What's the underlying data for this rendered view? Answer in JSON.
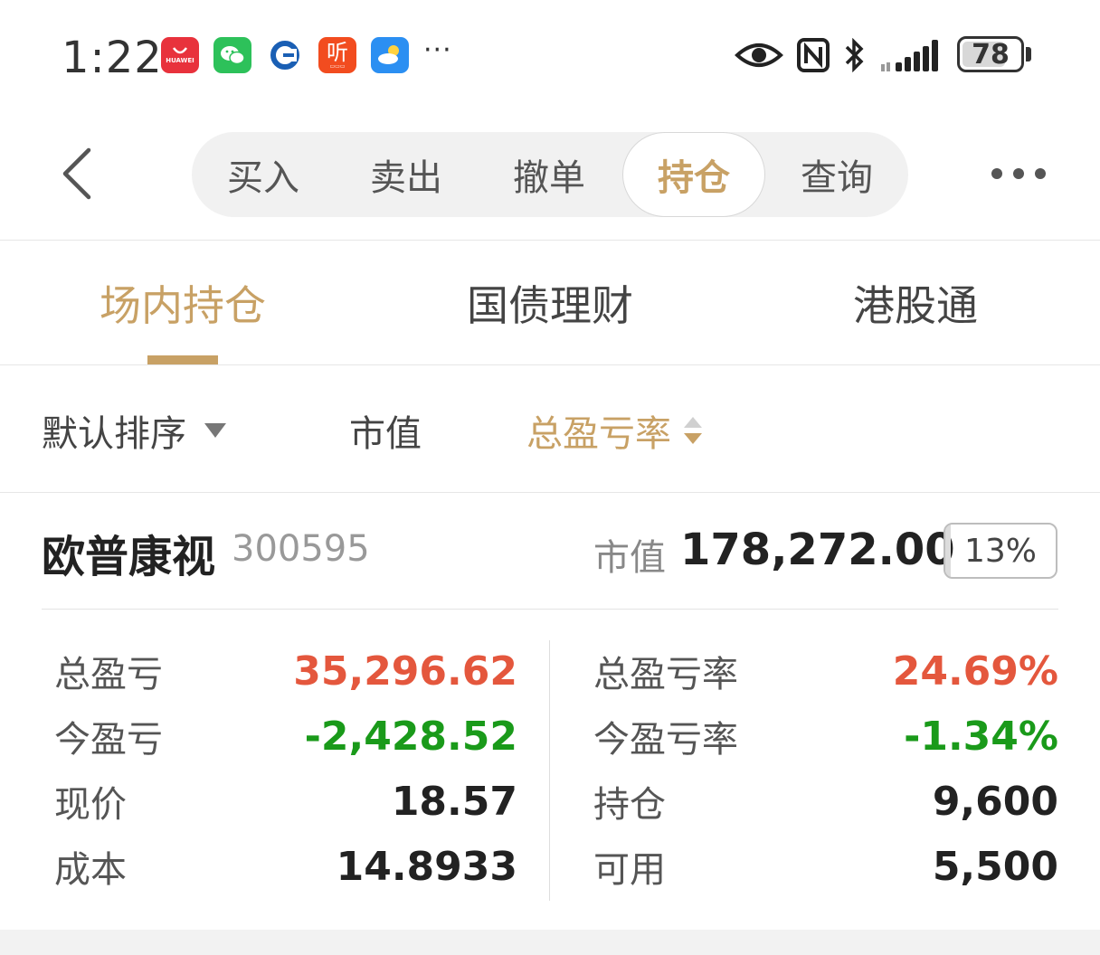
{
  "status_bar": {
    "time": "1:22",
    "apps": [
      {
        "name": "huawei-appgallery-icon",
        "text": "HUAWEI",
        "color": "#e8323c"
      },
      {
        "name": "wechat-icon",
        "text": "",
        "color": "#2dc15a"
      },
      {
        "name": "ccb-bank-icon",
        "text": "",
        "color": "#ffffff"
      },
      {
        "name": "ximalaya-listen-icon",
        "text": "听",
        "color": "#f24c1f"
      },
      {
        "name": "weather-icon",
        "text": "",
        "color": "#2b8ff2"
      }
    ],
    "more": "···",
    "battery": "78",
    "battery_level_pct": 78
  },
  "header": {
    "tabs": [
      "买入",
      "卖出",
      "撤单",
      "持仓",
      "查询"
    ],
    "active_tab": "持仓"
  },
  "sub_tabs": {
    "items": [
      "场内持仓",
      "国债理财",
      "港股通"
    ],
    "active": "场内持仓"
  },
  "sort_bar": {
    "default_sort": "默认排序",
    "market_value": "市值",
    "total_pl_rate": "总盈亏率"
  },
  "holding": {
    "name": "欧普康视",
    "code": "300595",
    "market_value_label": "市值",
    "market_value": "178,272.00",
    "position_ratio": "13%",
    "position_ratio_pct": 13,
    "left_stats": [
      {
        "label": "总盈亏",
        "value": "35,296.62",
        "tone": "red"
      },
      {
        "label": "今盈亏",
        "value": "-2,428.52",
        "tone": "green"
      },
      {
        "label": "现价",
        "value": "18.57",
        "tone": "normal"
      },
      {
        "label": "成本",
        "value": "14.8933",
        "tone": "normal"
      }
    ],
    "right_stats": [
      {
        "label": "总盈亏率",
        "value": "24.69%",
        "tone": "red"
      },
      {
        "label": "今盈亏率",
        "value": "-1.34%",
        "tone": "green"
      },
      {
        "label": "持仓",
        "value": "9,600",
        "tone": "normal"
      },
      {
        "label": "可用",
        "value": "5,500",
        "tone": "normal"
      }
    ]
  },
  "colors": {
    "accent_gold": "#c8a165",
    "profit_red": "#e4573d",
    "loss_green": "#1a9a1a"
  }
}
